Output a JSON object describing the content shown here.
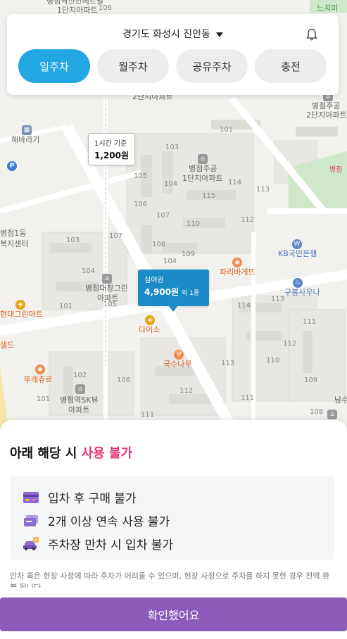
{
  "header": {
    "location": "경기도 화성시 진안동",
    "tabs": [
      {
        "label": "일주차",
        "active": true
      },
      {
        "label": "월주차",
        "active": false
      },
      {
        "label": "공유주차",
        "active": false
      },
      {
        "label": "충전",
        "active": false
      }
    ]
  },
  "map": {
    "labels": {
      "top_apt": "병점역신안메트빌",
      "top_apt2": "1단지아파트",
      "top_num": "106",
      "apt2_top": "2단지아파트",
      "habari": "해바라기",
      "bj_jugong1": "병점주공",
      "bj_jugong1b": "1단지아파트",
      "bj_jugong2": "병점주공",
      "bj_jugong2b": "2단지아파트",
      "bj1dong": "병점1동",
      "bokji": "복지센터",
      "daechang": "병점대창그린",
      "daechang2": "아파트",
      "paris": "파리바게뜨",
      "kb": "KB국민은행",
      "sauna": "구봉사우나",
      "hyundai": "현대그린마트",
      "daiso": "다이소",
      "guksu": "국수나무",
      "tous": "뚜레쥬르",
      "skview": "병점역SK뷰",
      "skview2": "아파트",
      "salad": "샐드",
      "neuchimi": "느치미",
      "namsu": "남수",
      "byeongjeom": "병점"
    },
    "bldg_numbers": [
      "101",
      "102",
      "103",
      "104",
      "105",
      "106",
      "107",
      "108",
      "109",
      "110",
      "111",
      "112",
      "113",
      "114",
      "115"
    ],
    "bubbles": {
      "hourly": {
        "title": "1시간 기준",
        "price": "1,200원"
      },
      "selected": {
        "title": "심야권",
        "price": "4,900원",
        "extra": "외 1종"
      }
    },
    "colors": {
      "selected_bubble": "#1a8bc7",
      "park": "#cfe8c9",
      "water_blue": "#dbe6f3"
    }
  },
  "sheet": {
    "title_prefix": "아래 해당 시 ",
    "title_highlight": "사용 불가",
    "items": [
      {
        "icon": "credit-card-icon",
        "text": "입차 후 구매 불가"
      },
      {
        "icon": "tickets-icon",
        "text": "2개 이상 연속 사용 불가"
      },
      {
        "icon": "car-parking-icon",
        "text": "주차장 만차 시 입차 불가"
      }
    ],
    "fine_print": "만차 혹은 현장 사정에 따라 주차가 어려울 수 있으며, 현장 사정으로 주차를 하지 못한 경우 전액 환불 됩니다.",
    "confirm_label": "확인했어요"
  },
  "colors": {
    "accent_tab": "#22a7e3",
    "highlight": "#e8306a",
    "confirm": "#8c5ab8"
  }
}
